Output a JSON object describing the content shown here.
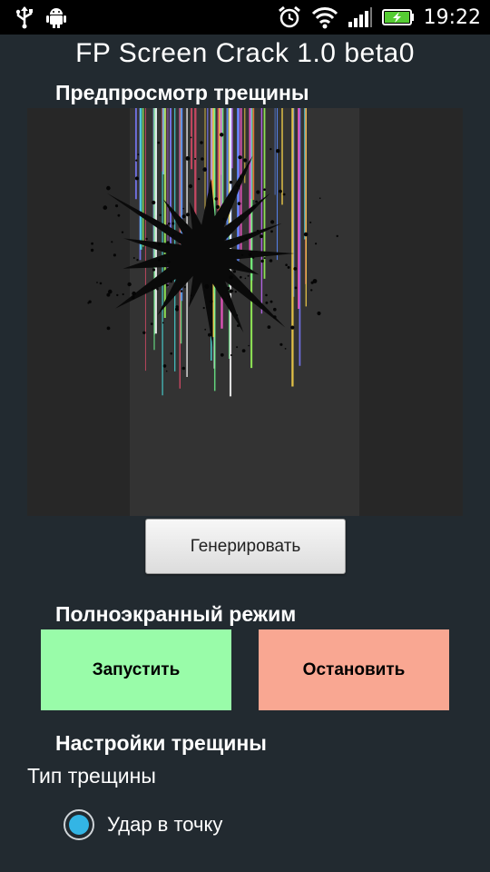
{
  "status_bar": {
    "time": "19:22",
    "left_icons": [
      "usb-icon",
      "android-debug-icon"
    ],
    "right_icons": [
      "alarm-icon",
      "wifi-icon",
      "signal-icon",
      "battery-charging-icon"
    ]
  },
  "app": {
    "title": "FP Screen Crack  1.0 beta0"
  },
  "preview": {
    "heading": "Предпросмотр трещины"
  },
  "generate_button": {
    "label": "Генерировать"
  },
  "fullscreen": {
    "heading": "Полноэкранный режим",
    "start_label": "Запустить",
    "stop_label": "Остановить",
    "start_color": "#99fca9",
    "stop_color": "#f9a792"
  },
  "settings": {
    "heading": "Настройки трещины",
    "crack_type_label": "Тип трещины",
    "options": [
      {
        "label": "Удар в точку",
        "selected": true
      }
    ],
    "accent_color": "#33b5e5"
  }
}
